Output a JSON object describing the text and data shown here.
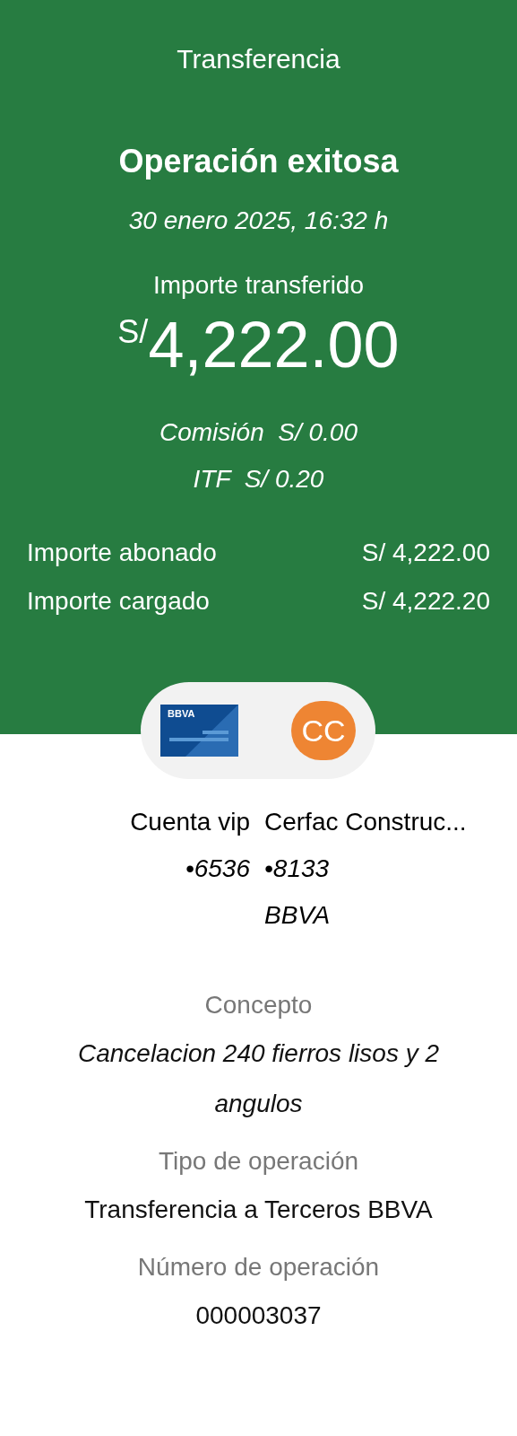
{
  "header": {
    "title": "Transferencia",
    "status": "Operación exitosa",
    "datetime": "30 enero 2025, 16:32 h",
    "amount_label": "Importe transferido",
    "currency": "S/",
    "amount": "4,222.00",
    "fees": [
      {
        "label": "Comisión",
        "value": "S/ 0.00"
      },
      {
        "label": "ITF",
        "value": "S/ 0.20"
      }
    ],
    "totals": [
      {
        "label": "Importe abonado",
        "value": "S/ 4,222.00"
      },
      {
        "label": "Importe cargado",
        "value": "S/ 4,222.20"
      }
    ]
  },
  "transfer": {
    "card_label": "BBVA",
    "avatar": "CC",
    "origin": {
      "name": "Cuenta vip",
      "number": "•6536"
    },
    "destination": {
      "name": "Cerfac Construc...",
      "number": "•8133",
      "bank": "BBVA"
    }
  },
  "details": [
    {
      "label": "Concepto",
      "value": "Cancelacion 240 fierros lisos y 2 angulos",
      "italic": true
    },
    {
      "label": "Tipo de operación",
      "value": "Transferencia a Terceros BBVA",
      "italic": false
    },
    {
      "label": "Número de operación",
      "value": "000003037",
      "italic": false
    }
  ]
}
